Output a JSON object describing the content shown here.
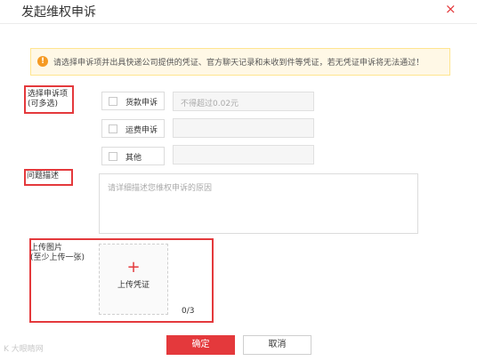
{
  "dialog": {
    "title": "发起维权申诉",
    "close_icon": "×"
  },
  "alert": {
    "icon": "!",
    "text": "请选择申诉项并出具快递公司提供的凭证、官方聊天记录和未收到件等凭证，若无凭证申诉将无法通过！"
  },
  "items_section": {
    "label_line1": "选择申诉项",
    "label_line2": "(可多选)",
    "options": [
      {
        "label": "货款申诉",
        "checked": false,
        "input_placeholder": "不得超过0.02元"
      },
      {
        "label": "运费申诉",
        "checked": false,
        "input_placeholder": ""
      },
      {
        "label": "其他",
        "checked": false,
        "input_placeholder": ""
      }
    ]
  },
  "description": {
    "label": "问题描述",
    "placeholder": "请详细描述您维权申诉的原因"
  },
  "upload": {
    "label_line1": "上传图片",
    "label_line2": "(至少上传一张)",
    "plus": "+",
    "button_text": "上传凭证",
    "count": "0/3"
  },
  "footer": {
    "ok_label": "确定",
    "cancel_label": "取消"
  },
  "watermark": "K 大眼睛网"
}
